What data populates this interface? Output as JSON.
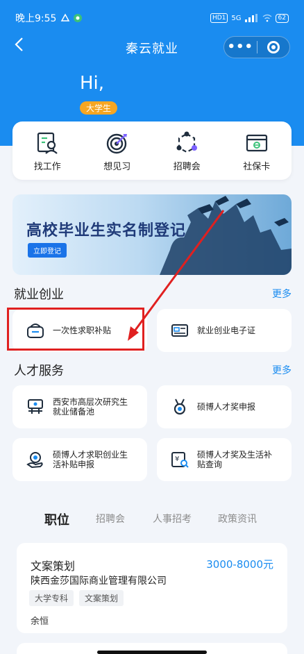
{
  "status_bar": {
    "time": "晚上9:55",
    "hd_badge": "HD1",
    "network": "5G",
    "battery": "62"
  },
  "nav": {
    "back_icon": "chevron-left-icon",
    "title": "秦云就业",
    "more_icon": "more-dots-icon",
    "close_icon": "target-circle-icon"
  },
  "greeting": {
    "hello": "Hi,",
    "role": "大学生"
  },
  "quick_actions": [
    {
      "label": "找工作",
      "icon": "resume-person-icon"
    },
    {
      "label": "想见习",
      "icon": "target-dart-icon"
    },
    {
      "label": "招聘会",
      "icon": "network-hexagon-icon"
    },
    {
      "label": "社保卡",
      "icon": "social-security-card-icon"
    }
  ],
  "banner": {
    "title": "高校毕业生实名制登记",
    "button": "立即登记"
  },
  "sections": {
    "employment": {
      "title": "就业创业",
      "more": "更多",
      "items": [
        {
          "label": "一次性求职补贴",
          "icon": "wallet-bag-icon"
        },
        {
          "label": "就业创业电子证",
          "icon": "id-card-icon"
        }
      ]
    },
    "talent": {
      "title": "人才服务",
      "more": "更多",
      "items": [
        {
          "line1": "西安市高层次研究生",
          "line2": "就业储备池",
          "icon": "building-pool-icon"
        },
        {
          "line1": "硕博人才奖申报",
          "line2": "",
          "icon": "medal-icon"
        },
        {
          "line1": "硕博人才求职创业生",
          "line2": "活补贴申报",
          "icon": "hand-coin-icon"
        },
        {
          "line1": "硕博人才奖及生活补",
          "line2": "贴查询",
          "icon": "yuan-search-icon"
        }
      ]
    }
  },
  "tabs": [
    "职位",
    "招聘会",
    "人事招考",
    "政策资讯"
  ],
  "active_tab": "职位",
  "job": {
    "title": "文案策划",
    "salary": "3000-8000元",
    "company": "陕西金莎国际商业管理有限公司",
    "tags": [
      "大学专科",
      "文案策划"
    ],
    "contact": "余恒"
  },
  "colors": {
    "primary": "#1a8cf0",
    "badge": "#f5a623",
    "annotation": "#e02020"
  }
}
